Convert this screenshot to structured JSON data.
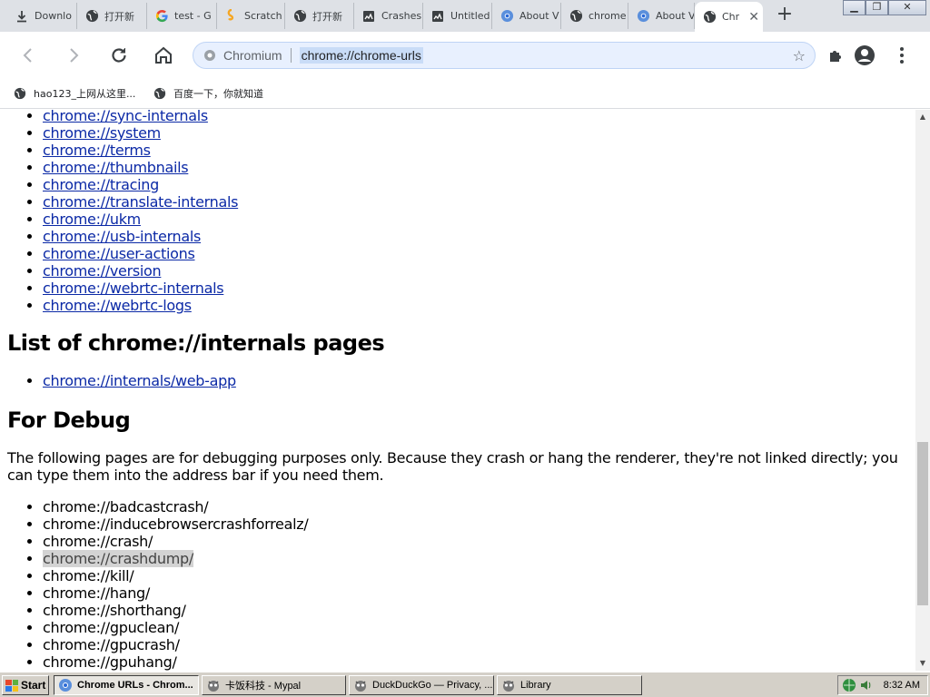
{
  "tabs": [
    {
      "title": "Downlo",
      "icon": "download-icon"
    },
    {
      "title": "打开新",
      "icon": "globe-icon"
    },
    {
      "title": "test - G",
      "icon": "google-icon"
    },
    {
      "title": "Scratch",
      "icon": "scratch-icon"
    },
    {
      "title": "打开新",
      "icon": "globe-icon"
    },
    {
      "title": "Crashes",
      "icon": "crash-icon"
    },
    {
      "title": "Untitled",
      "icon": "crash-icon"
    },
    {
      "title": "About V",
      "icon": "chromium-icon"
    },
    {
      "title": "chrome",
      "icon": "globe-icon"
    },
    {
      "title": "About V",
      "icon": "chromium-icon"
    },
    {
      "title": "Chr",
      "icon": "globe-icon",
      "active": true
    }
  ],
  "toolbar": {
    "origin_label": "Chromium",
    "url": "chrome://chrome-urls"
  },
  "bookmarks": [
    {
      "label": "hao123_上网从这里..."
    },
    {
      "label": "百度一下，你就知道"
    }
  ],
  "content": {
    "top_links": [
      "chrome://sync-internals",
      "chrome://system",
      "chrome://terms",
      "chrome://thumbnails",
      "chrome://tracing",
      "chrome://translate-internals",
      "chrome://ukm",
      "chrome://usb-internals",
      "chrome://user-actions",
      "chrome://version",
      "chrome://webrtc-internals",
      "chrome://webrtc-logs"
    ],
    "internals_heading": "List of chrome://internals pages",
    "internals_links": [
      "chrome://internals/web-app"
    ],
    "debug_heading": "For Debug",
    "debug_text": "The following pages are for debugging purposes only. Because they crash or hang the renderer, they're not linked directly; you can type them into the address bar if you need them.",
    "debug_items": [
      "chrome://badcastcrash/",
      "chrome://inducebrowsercrashforrealz/",
      "chrome://crash/",
      "chrome://crashdump/",
      "chrome://kill/",
      "chrome://hang/",
      "chrome://shorthang/",
      "chrome://gpuclean/",
      "chrome://gpucrash/",
      "chrome://gpuhang/"
    ],
    "highlighted_index": 3
  },
  "taskbar": {
    "start_label": "Start",
    "tasks": [
      {
        "label": "Chrome URLs - Chrom...",
        "active": true
      },
      {
        "label": "卡饭科技 - Mypal"
      },
      {
        "label": "DuckDuckGo — Privacy, ..."
      },
      {
        "label": "Library"
      }
    ],
    "clock": "8:32 AM"
  },
  "colors": {
    "link": "#0b29a6",
    "tabstrip_bg": "#dee1e6",
    "omnibox_bg": "#e8f0fe",
    "taskbar_bg": "#d4d0c8"
  }
}
